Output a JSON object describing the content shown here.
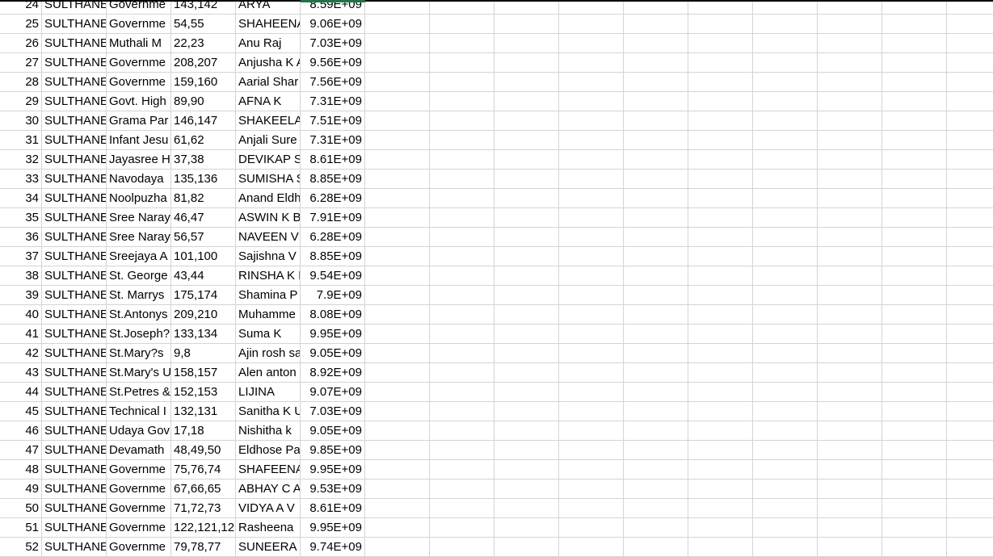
{
  "sheet": {
    "active_cell_column": "F",
    "accent_color": "#217346",
    "rows": [
      [
        "24",
        "SULTHANE",
        "Governme",
        "143,142",
        "ARYA",
        "8.59E+09"
      ],
      [
        "25",
        "SULTHANE",
        "Governme",
        "54,55",
        "SHAHEENA",
        "9.06E+09"
      ],
      [
        "26",
        "SULTHANE",
        "Muthali M",
        "22,23",
        "Anu Raj",
        "7.03E+09"
      ],
      [
        "27",
        "SULTHANE",
        "Governme",
        "208,207",
        "Anjusha K A",
        "9.56E+09"
      ],
      [
        "28",
        "SULTHANE",
        "Governme",
        "159,160",
        "Aarial Shar",
        "7.56E+09"
      ],
      [
        "29",
        "SULTHANE",
        "Govt. High",
        "89,90",
        "AFNA K",
        "7.31E+09"
      ],
      [
        "30",
        "SULTHANE",
        "Grama Par",
        "146,147",
        "SHAKEELA",
        "7.51E+09"
      ],
      [
        "31",
        "SULTHANE",
        "Infant Jesu",
        "61,62",
        "Anjali Sure",
        "7.31E+09"
      ],
      [
        "32",
        "SULTHANE",
        "Jayasree H",
        "37,38",
        "DEVIKAP S",
        "8.61E+09"
      ],
      [
        "33",
        "SULTHANE",
        "Navodaya",
        "135,136",
        "SUMISHA S",
        "8.85E+09"
      ],
      [
        "34",
        "SULTHANE",
        "Noolpuzha",
        "81,82",
        "Anand Eldh",
        "6.28E+09"
      ],
      [
        "35",
        "SULTHANE",
        "Sree Naray",
        "46,47",
        "ASWIN K B",
        "7.91E+09"
      ],
      [
        "36",
        "SULTHANE",
        "Sree Naray",
        "56,57",
        "NAVEEN V",
        "6.28E+09"
      ],
      [
        "37",
        "SULTHANE",
        "Sreejaya A",
        "101,100",
        "Sajishna V",
        "8.85E+09"
      ],
      [
        "38",
        "SULTHANE",
        "St. George",
        "43,44",
        "RINSHA K I",
        "9.54E+09"
      ],
      [
        "39",
        "SULTHANE",
        "St. Marrys",
        "175,174",
        "Shamina P",
        "7.9E+09"
      ],
      [
        "40",
        "SULTHANE",
        "St.Antonys",
        "209,210",
        "Muhamme",
        "8.08E+09"
      ],
      [
        "41",
        "SULTHANE",
        "St.Joseph?",
        "133,134",
        "Suma K",
        "9.95E+09"
      ],
      [
        "42",
        "SULTHANE",
        "St.Mary?s",
        "9,8",
        "Ajin rosh sa",
        "9.05E+09"
      ],
      [
        "43",
        "SULTHANE",
        "St.Mary's U",
        "158,157",
        "Alen anton",
        "8.92E+09"
      ],
      [
        "44",
        "SULTHANE",
        "St.Petres &",
        "152,153",
        "LIJINA",
        "9.07E+09"
      ],
      [
        "45",
        "SULTHANE",
        "Technical I",
        "132,131",
        "Sanitha K U",
        "7.03E+09"
      ],
      [
        "46",
        "SULTHANE",
        "Udaya Gov",
        "17,18",
        "Nishitha k",
        "9.05E+09"
      ],
      [
        "47",
        "SULTHANE",
        "Devamath",
        "48,49,50",
        "Eldhose Pa",
        "9.85E+09"
      ],
      [
        "48",
        "SULTHANE",
        "Governme",
        "75,76,74",
        "SHAFEENA",
        "9.95E+09"
      ],
      [
        "49",
        "SULTHANE",
        "Governme",
        "67,66,65",
        "ABHAY C A",
        "9.53E+09"
      ],
      [
        "50",
        "SULTHANE",
        "Governme",
        "71,72,73",
        "VIDYA A V",
        "8.61E+09"
      ],
      [
        "51",
        "SULTHANE",
        "Governme",
        "122,121,12",
        "Rasheena",
        "9.95E+09"
      ],
      [
        "52",
        "SULTHANE",
        "Governme",
        "79,78,77",
        "SUNEERA T",
        "9.74E+09"
      ]
    ]
  }
}
